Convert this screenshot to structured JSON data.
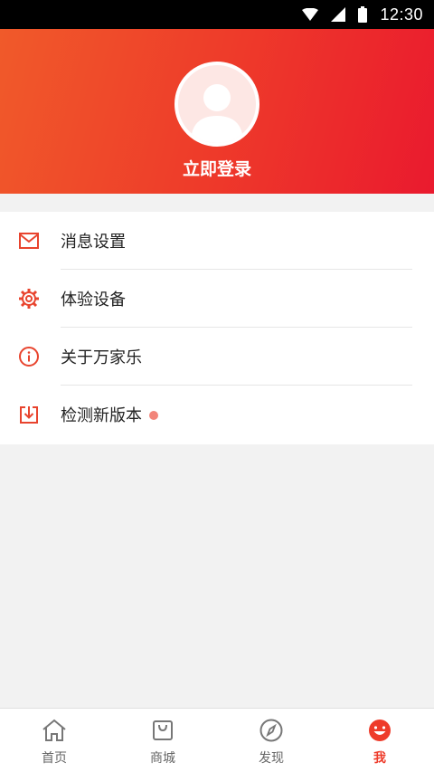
{
  "status_bar": {
    "time": "12:30"
  },
  "header": {
    "login_label": "立即登录"
  },
  "menu": {
    "items": [
      {
        "label": "消息设置",
        "icon": "mail-icon"
      },
      {
        "label": "体验设备",
        "icon": "gear-icon"
      },
      {
        "label": "关于万家乐",
        "icon": "info-icon"
      },
      {
        "label": "检测新版本",
        "icon": "download-icon",
        "badge": "red-dot"
      }
    ]
  },
  "bottom_nav": {
    "items": [
      {
        "label": "首页",
        "icon": "home-icon",
        "active": false
      },
      {
        "label": "商城",
        "icon": "shopping-bag-icon",
        "active": false
      },
      {
        "label": "发现",
        "icon": "compass-icon",
        "active": false
      },
      {
        "label": "我",
        "icon": "smiley-face-icon",
        "active": true
      }
    ]
  },
  "colors": {
    "accent": "#ee3b2a",
    "icon_red": "#e8442e",
    "badge": "#f2857a"
  }
}
